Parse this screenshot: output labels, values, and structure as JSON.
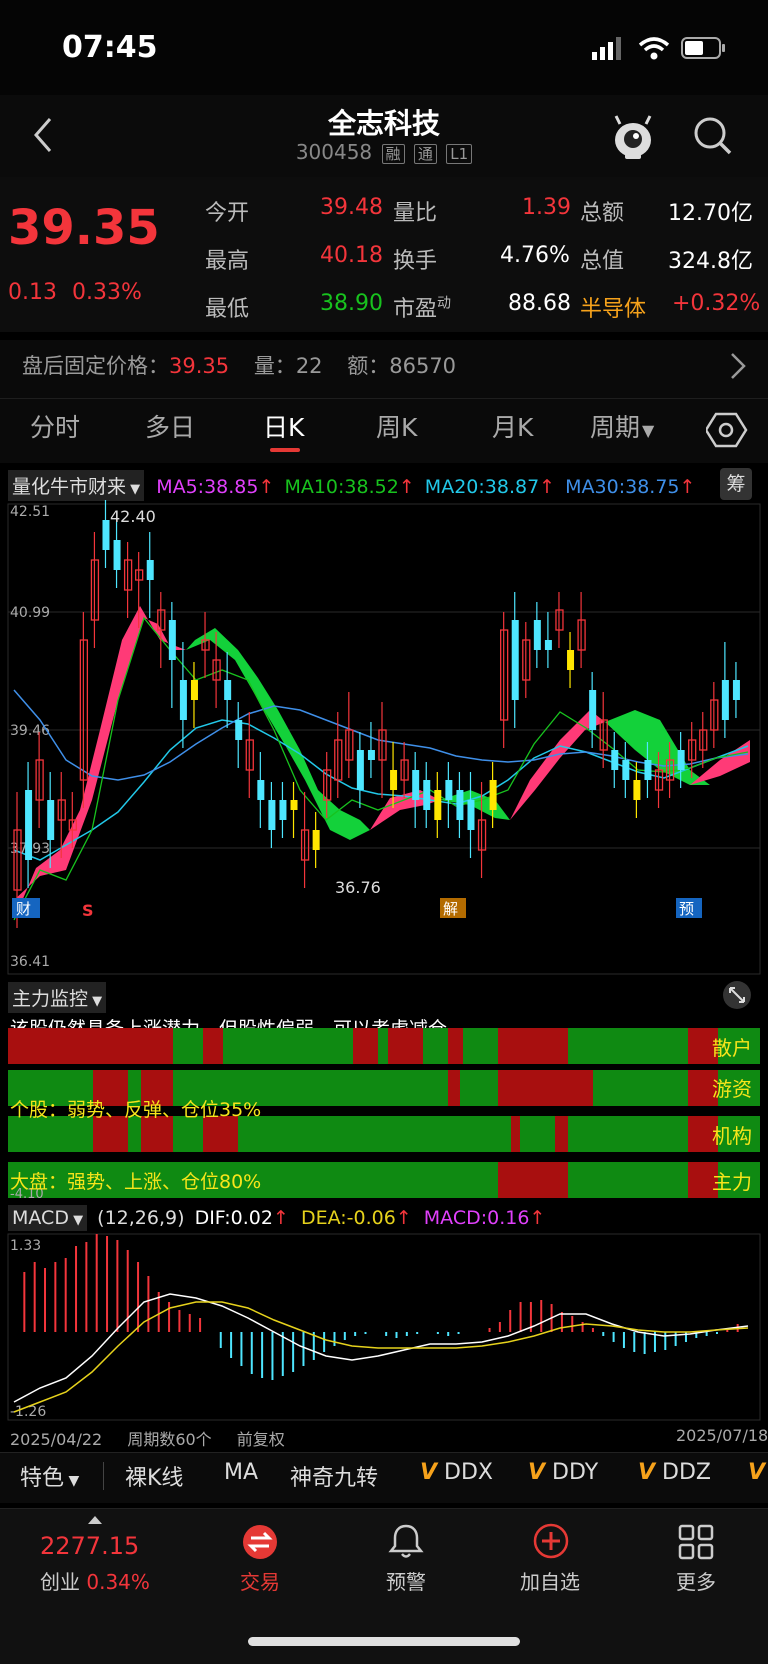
{
  "status": {
    "time": "07:45"
  },
  "nav": {
    "title": "全志科技",
    "code": "300458",
    "tags": [
      "融",
      "通",
      "L1"
    ]
  },
  "quote": {
    "price": "39.35",
    "change": "0.13",
    "change_pct": "0.33%",
    "fields": [
      {
        "label": "今开",
        "value": "39.48",
        "color": "red"
      },
      {
        "label": "量比",
        "value": "1.39",
        "color": "red"
      },
      {
        "label": "总额",
        "value": "12.70亿",
        "color": "white"
      },
      {
        "label": "最高",
        "value": "40.18",
        "color": "red"
      },
      {
        "label": "换手",
        "value": "4.76%",
        "color": "white"
      },
      {
        "label": "总值",
        "value": "324.8亿",
        "color": "white"
      },
      {
        "label": "最低",
        "value": "38.90",
        "color": "green"
      },
      {
        "label": "市盈",
        "sup": "动",
        "value": "88.68",
        "color": "white"
      },
      {
        "label": "半导体",
        "value": "+0.32%",
        "color": "red"
      }
    ]
  },
  "after_hours": {
    "label": "盘后固定价格：",
    "price": "39.35",
    "vol_label": "量：",
    "vol": "22",
    "amt_label": "额：",
    "amt": "86570"
  },
  "tabs": [
    "分时",
    "多日",
    "日K",
    "周K",
    "月K",
    "周期"
  ],
  "kline": {
    "indicator_name": "量化牛市财来",
    "ma": [
      {
        "label": "MA5:38.85",
        "color": "#e040fb"
      },
      {
        "label": "MA10:38.52",
        "color": "#18c21e"
      },
      {
        "label": "MA20:38.87",
        "color": "#22c8e8"
      },
      {
        "label": "MA30:38.75",
        "color": "#3f8fe8"
      }
    ],
    "chou_label": "筹",
    "y_labels": [
      "42.51",
      "40.99",
      "39.46",
      "37.93",
      "36.41"
    ],
    "high_label": "42.40",
    "low_label": "36.76",
    "markers": [
      "财",
      "S",
      "解",
      "预"
    ]
  },
  "monitor": {
    "title": "主力监控",
    "comment": "该股仍然具备上涨潜力，但股性偏弱，可以考虑减仓。",
    "rows": [
      {
        "label": "散户",
        "text": ""
      },
      {
        "label": "游资",
        "text": "个股：弱势、反弹、仓位35%"
      },
      {
        "label": "机构",
        "text": ""
      },
      {
        "label": "主力",
        "text": "大盘：强势、上涨、仓位80%"
      }
    ],
    "axis_label": "-4.10"
  },
  "macd": {
    "title": "MACD",
    "params": "(12,26,9)",
    "dif": "DIF:0.02",
    "dea": "DEA:-0.06",
    "macd": "MACD:0.16",
    "y_top": "1.33",
    "y_bottom": "-1.26",
    "date_start": "2025/04/22",
    "periods": "周期数60个",
    "adjust": "前复权",
    "date_end": "2025/07/18"
  },
  "menu": [
    "特色",
    "裸K线",
    "MA",
    "神奇九转",
    "DDX",
    "DDY",
    "DDZ"
  ],
  "tabbar": {
    "index_value": "2277.15",
    "index_name": "创业",
    "index_pct": "0.34%",
    "items": [
      "交易",
      "预警",
      "加自选",
      "更多"
    ]
  },
  "colors": {
    "up": "#f3353b",
    "down": "#18c21e",
    "accent": "#e53935"
  }
}
